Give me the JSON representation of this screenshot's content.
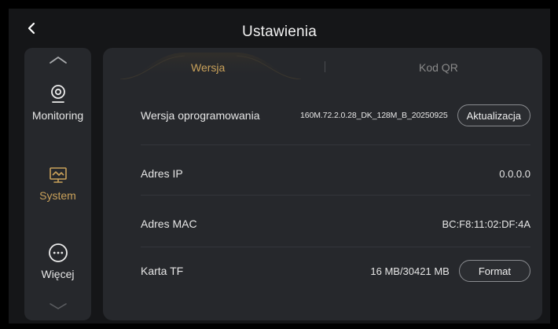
{
  "header": {
    "title": "Ustawienia"
  },
  "sidebar": {
    "items": [
      {
        "label": "Monitoring",
        "icon": "camera-icon",
        "active": false
      },
      {
        "label": "System",
        "icon": "monitor-icon",
        "active": true
      },
      {
        "label": "Więcej",
        "icon": "more-icon",
        "active": false
      }
    ]
  },
  "tabs": [
    {
      "label": "Wersja",
      "active": true
    },
    {
      "label": "Kod QR",
      "active": false
    }
  ],
  "info": {
    "firmware": {
      "label": "Wersja oprogramowania",
      "value": "160M.72.2.0.28_DK_128M_B_20250925",
      "button": "Aktualizacja"
    },
    "ip": {
      "label": "Adres IP",
      "value": "0.0.0.0"
    },
    "mac": {
      "label": "Adres MAC",
      "value": "BC:F8:11:02:DF:4A"
    },
    "tf": {
      "label": "Karta TF",
      "value": "16 MB/30421 MB",
      "button": "Format"
    }
  },
  "colors": {
    "background": "#151618",
    "panel": "#26282c",
    "accent": "#c9a15a",
    "text": "#e6e6e6",
    "inactive_tab": "#8a8a8a"
  }
}
